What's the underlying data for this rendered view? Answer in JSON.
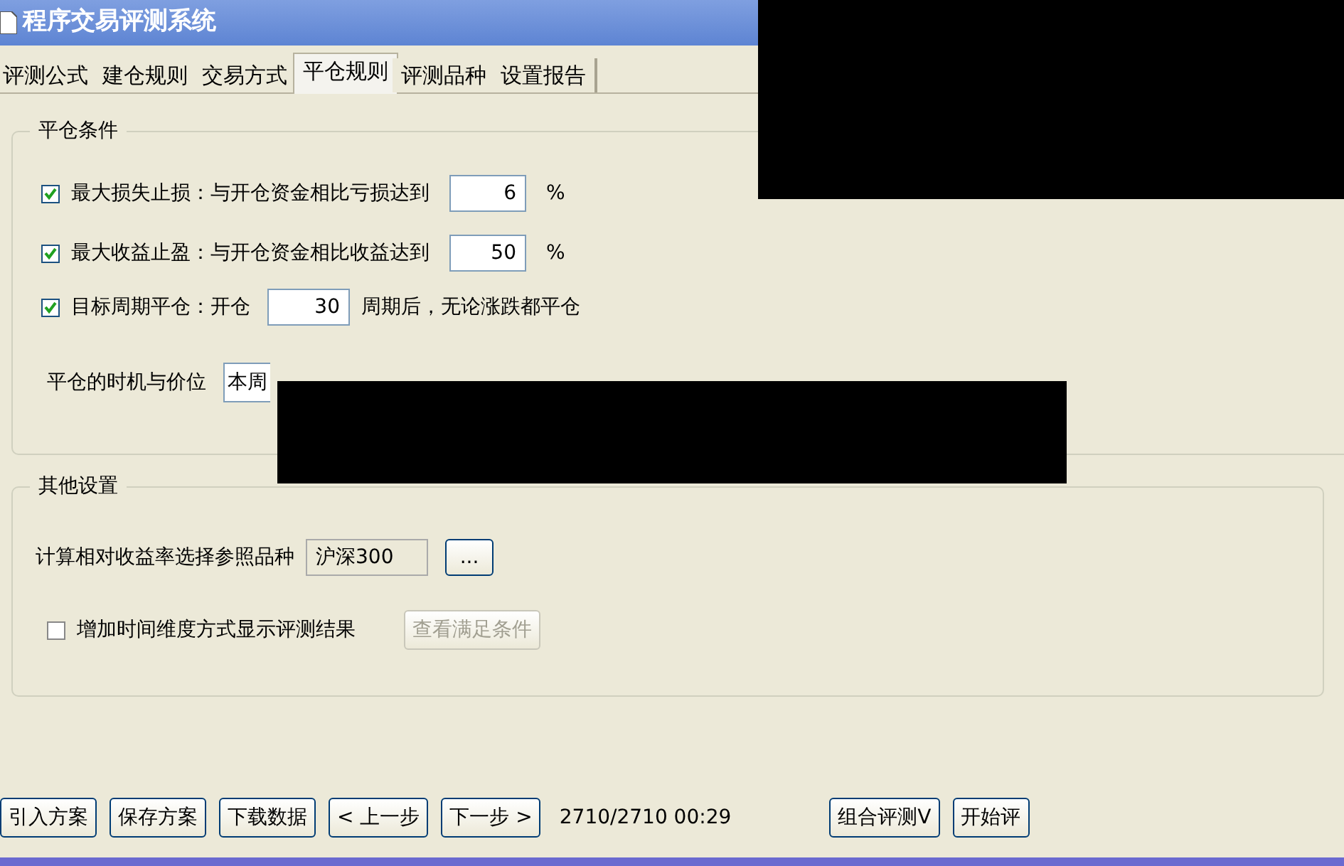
{
  "window": {
    "title": "程序交易评测系统"
  },
  "tabs": [
    {
      "label": "评测公式",
      "selected": false
    },
    {
      "label": "建仓规则",
      "selected": false
    },
    {
      "label": "交易方式",
      "selected": false
    },
    {
      "label": "平仓规则",
      "selected": true
    },
    {
      "label": "评测品种",
      "selected": false
    },
    {
      "label": "设置报告",
      "selected": false
    }
  ],
  "close_conditions": {
    "title": "平仓条件",
    "rules": [
      {
        "checked": true,
        "label": "最大损失止损：与开仓资金相比亏损达到",
        "value": "6",
        "unit": "%"
      },
      {
        "checked": true,
        "label": "最大收益止盈：与开仓资金相比收益达到",
        "value": "50",
        "unit": "%"
      }
    ],
    "period_rule": {
      "checked": true,
      "label": "目标周期平仓：开仓",
      "value": "30",
      "suffix": "周期后，无论涨跌都平仓"
    },
    "timing": {
      "label": "平仓的时机与价位",
      "value": "本周"
    }
  },
  "other_settings": {
    "title": "其他设置",
    "benchmark": {
      "label": "计算相对收益率选择参照品种",
      "value": "沪深300",
      "browse": "..."
    },
    "time_dimension": {
      "checked": false,
      "label": "增加时间维度方式显示评测结果",
      "button": "查看满足条件",
      "button_disabled": true
    }
  },
  "toolbar": {
    "left_buttons": [
      "引入方案",
      "保存方案",
      "下载数据",
      "< 上一步",
      "下一步 >"
    ],
    "status": "2710/2710 00:29",
    "right_buttons": [
      "组合评测V",
      "开始评"
    ]
  }
}
